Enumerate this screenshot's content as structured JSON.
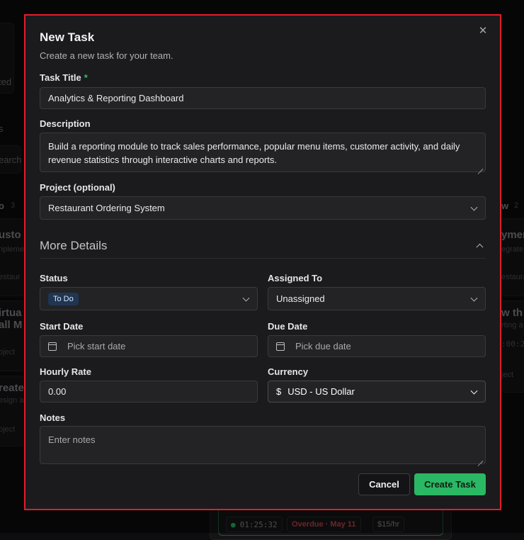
{
  "modal": {
    "title": "New Task",
    "subtitle": "Create a new task for your team.",
    "close_icon": "close-icon"
  },
  "form": {
    "task_title": {
      "label": "Task Title",
      "required_mark": "*",
      "value": "Analytics & Reporting Dashboard"
    },
    "description": {
      "label": "Description",
      "value": "Build a reporting module to track sales performance, popular menu items, customer activity, and daily revenue statistics through interactive charts and reports."
    },
    "project": {
      "label": "Project (optional)",
      "value": "Restaurant Ordering System"
    },
    "more_details": {
      "label": "More Details"
    },
    "status": {
      "label": "Status",
      "value": "To Do"
    },
    "assigned_to": {
      "label": "Assigned To",
      "value": "Unassigned"
    },
    "start_date": {
      "label": "Start Date",
      "placeholder": "Pick start date"
    },
    "due_date": {
      "label": "Due Date",
      "placeholder": "Pick due date"
    },
    "hourly_rate": {
      "label": "Hourly Rate",
      "value": "0.00"
    },
    "currency": {
      "label": "Currency",
      "symbol": "$",
      "value": "USD - US Dollar"
    },
    "notes": {
      "label": "Notes",
      "placeholder": "Enter notes"
    }
  },
  "actions": {
    "cancel": "Cancel",
    "create": "Create Task"
  },
  "background": {
    "left_texts": [
      "ted",
      "s",
      "earch t",
      "o",
      "3",
      "usto",
      "nplemen",
      "estaur",
      "irtua",
      "all M",
      "oject",
      "reate",
      "esign a",
      "oject"
    ],
    "right_texts": [
      "w",
      "2",
      "ymen",
      "egrate",
      "estaura",
      "w th",
      "rting a",
      ":00:2",
      "ject"
    ],
    "bottom": {
      "timer": "01:25:32",
      "overdue": "Overdue · May 11",
      "rate": "$15/hr"
    }
  },
  "colors": {
    "accent_green": "#2bb864",
    "required_green": "#22c55e",
    "status_badge_bg": "#1f3552",
    "highlight_border": "#e11d2a"
  }
}
